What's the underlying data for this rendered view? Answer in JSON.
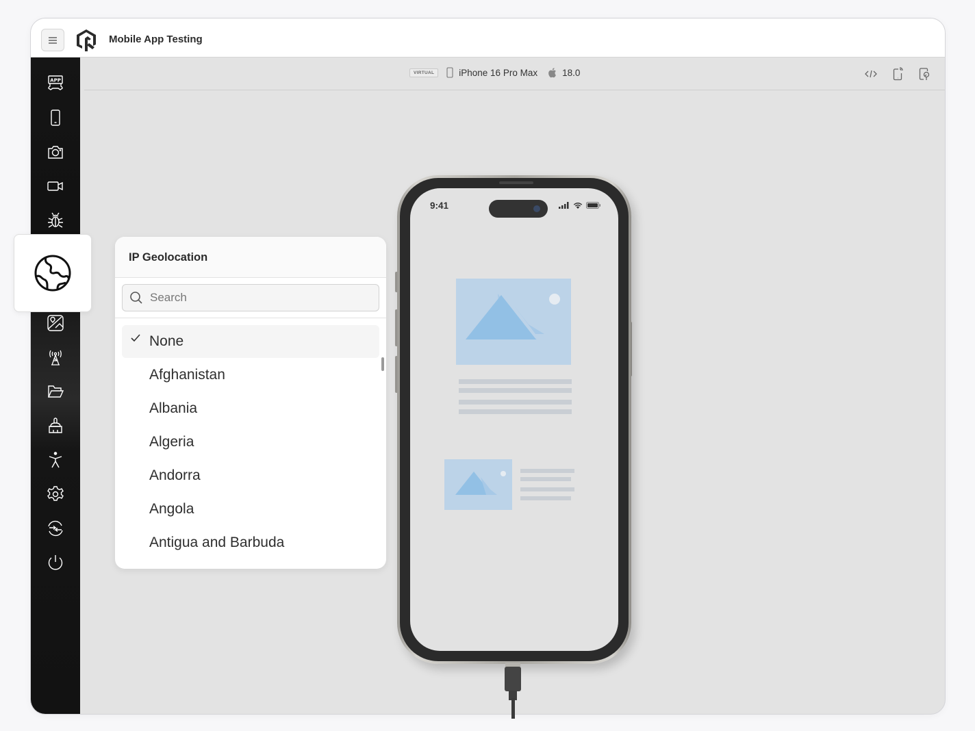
{
  "header": {
    "app_title": "Mobile App Testing",
    "menu_icon": "hamburger-menu-icon",
    "logo_icon": "brand-logo-icon"
  },
  "sidebar": {
    "items": [
      {
        "id": "app",
        "icon": "app-install-icon"
      },
      {
        "id": "device",
        "icon": "mobile-device-icon"
      },
      {
        "id": "camera",
        "icon": "camera-icon"
      },
      {
        "id": "video",
        "icon": "video-camera-icon"
      },
      {
        "id": "debug",
        "icon": "bug-icon"
      },
      {
        "id": "geolocation",
        "icon": "globe-icon",
        "active": true
      },
      {
        "id": "image-injection",
        "icon": "image-location-icon"
      },
      {
        "id": "network",
        "icon": "antenna-icon"
      },
      {
        "id": "files",
        "icon": "folder-icon"
      },
      {
        "id": "clean",
        "icon": "brush-icon"
      },
      {
        "id": "accessibility",
        "icon": "accessibility-icon"
      },
      {
        "id": "settings",
        "icon": "gear-icon"
      },
      {
        "id": "switch",
        "icon": "switch-session-icon"
      },
      {
        "id": "power",
        "icon": "power-icon"
      }
    ]
  },
  "device_bar": {
    "badge": "VIRTUAL",
    "device_name": "iPhone 16 Pro Max",
    "os_version": "18.0",
    "tools": [
      {
        "id": "inspector",
        "icon": "code-icon"
      },
      {
        "id": "rotate",
        "icon": "device-signal-icon"
      },
      {
        "id": "inspect-device",
        "icon": "device-search-icon"
      }
    ]
  },
  "geolocation_panel": {
    "title": "IP Geolocation",
    "search": {
      "placeholder": "Search",
      "value": ""
    },
    "selected": "None",
    "options": [
      "None",
      "Afghanistan",
      "Albania",
      "Algeria",
      "Andorra",
      "Angola",
      "Antigua and Barbuda"
    ]
  },
  "phone_screen": {
    "time": "9:41"
  },
  "colors": {
    "sidebar_bg": "#141414",
    "canvas_bg": "#e3e3e3",
    "placeholder_image": "#bcd3e8",
    "placeholder_mountain": "#92c0e5",
    "placeholder_lines": "#c9ced4"
  }
}
